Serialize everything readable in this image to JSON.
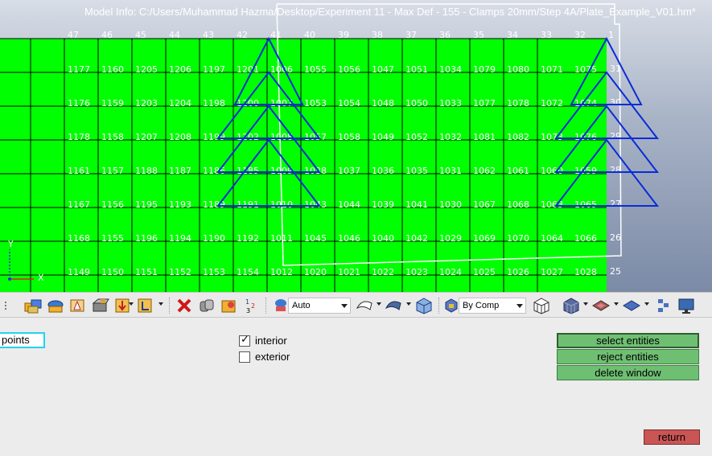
{
  "viewport": {
    "model_info": "Model Info: C:/Users/Muhammad Hazma/Desktop/Experiment 11 - Max Def - 155 - Clamps 20mm/Step 4A/Plate_Example_V01.hm*",
    "top_node_labels": [
      "47",
      "46",
      "45",
      "44",
      "43",
      "42",
      "41",
      "40",
      "39",
      "38",
      "37",
      "36",
      "35",
      "34",
      "33",
      "32",
      "1"
    ],
    "right_node_labels": [
      "31",
      "30",
      "29",
      "28",
      "27",
      "26",
      "25"
    ],
    "element_rows": [
      [
        "1177",
        "1160",
        "1205",
        "1206",
        "1197",
        "1201",
        "1006",
        "1055",
        "1056",
        "1047",
        "1051",
        "1034",
        "1079",
        "1080",
        "1071",
        "1075"
      ],
      [
        "1176",
        "1159",
        "1203",
        "1204",
        "1198",
        "1200",
        "1007",
        "1053",
        "1054",
        "1048",
        "1050",
        "1033",
        "1077",
        "1078",
        "1072",
        "1074"
      ],
      [
        "1178",
        "1158",
        "1207",
        "1208",
        "1199",
        "1202",
        "1008",
        "1057",
        "1058",
        "1049",
        "1052",
        "1032",
        "1081",
        "1082",
        "1073",
        "1076"
      ],
      [
        "1161",
        "1157",
        "1188",
        "1187",
        "1186",
        "1185",
        "1009",
        "1038",
        "1037",
        "1036",
        "1035",
        "1031",
        "1062",
        "1061",
        "1060",
        "1059"
      ],
      [
        "1167",
        "1156",
        "1195",
        "1193",
        "1189",
        "1191",
        "1010",
        "1043",
        "1044",
        "1039",
        "1041",
        "1030",
        "1067",
        "1068",
        "1063",
        "1065"
      ],
      [
        "1168",
        "1155",
        "1196",
        "1194",
        "1190",
        "1192",
        "1011",
        "1045",
        "1046",
        "1040",
        "1042",
        "1029",
        "1069",
        "1070",
        "1064",
        "1066"
      ],
      [
        "1149",
        "1150",
        "1151",
        "1152",
        "1153",
        "1154",
        "1012",
        "1020",
        "1021",
        "1022",
        "1023",
        "1024",
        "1025",
        "1026",
        "1027",
        "1028"
      ]
    ],
    "triad_y_label": "Y",
    "triad_x_label": "X"
  },
  "toolbar": {
    "display_mode_value": "Auto",
    "color_mode_value": "By Comp",
    "icons": [
      "component-visibility-icon",
      "assembly-icon",
      "solids-icon",
      "geometry-icon",
      "mesh-icon",
      "load-collectors-icon",
      "system-collector-icon",
      "delete-icon",
      "mask-icon",
      "unmask-icon",
      "numbers-icon",
      "shaded-mode-icon",
      "surface-icon",
      "surface-shaded-icon",
      "cube-icon",
      "by-comp-icon",
      "wireframe-icon",
      "element-shaded-icon",
      "feature-lines-icon",
      "transparency-icon",
      "layers-icon",
      "display-icon"
    ]
  },
  "panel": {
    "points_label": "points",
    "interior_label": "interior",
    "interior_checked": true,
    "exterior_label": "exterior",
    "exterior_checked": false,
    "select_entities_label": "select entities",
    "reject_entities_label": "reject entities",
    "delete_window_label": "delete window",
    "return_label": "return"
  },
  "colors": {
    "mesh_green": "#00ff00",
    "triangle_blue": "#0a2cd6",
    "window_white": "#ffffff",
    "button_green": "#6fbf73",
    "return_red": "#c95555",
    "points_border": "#22d3ee"
  }
}
